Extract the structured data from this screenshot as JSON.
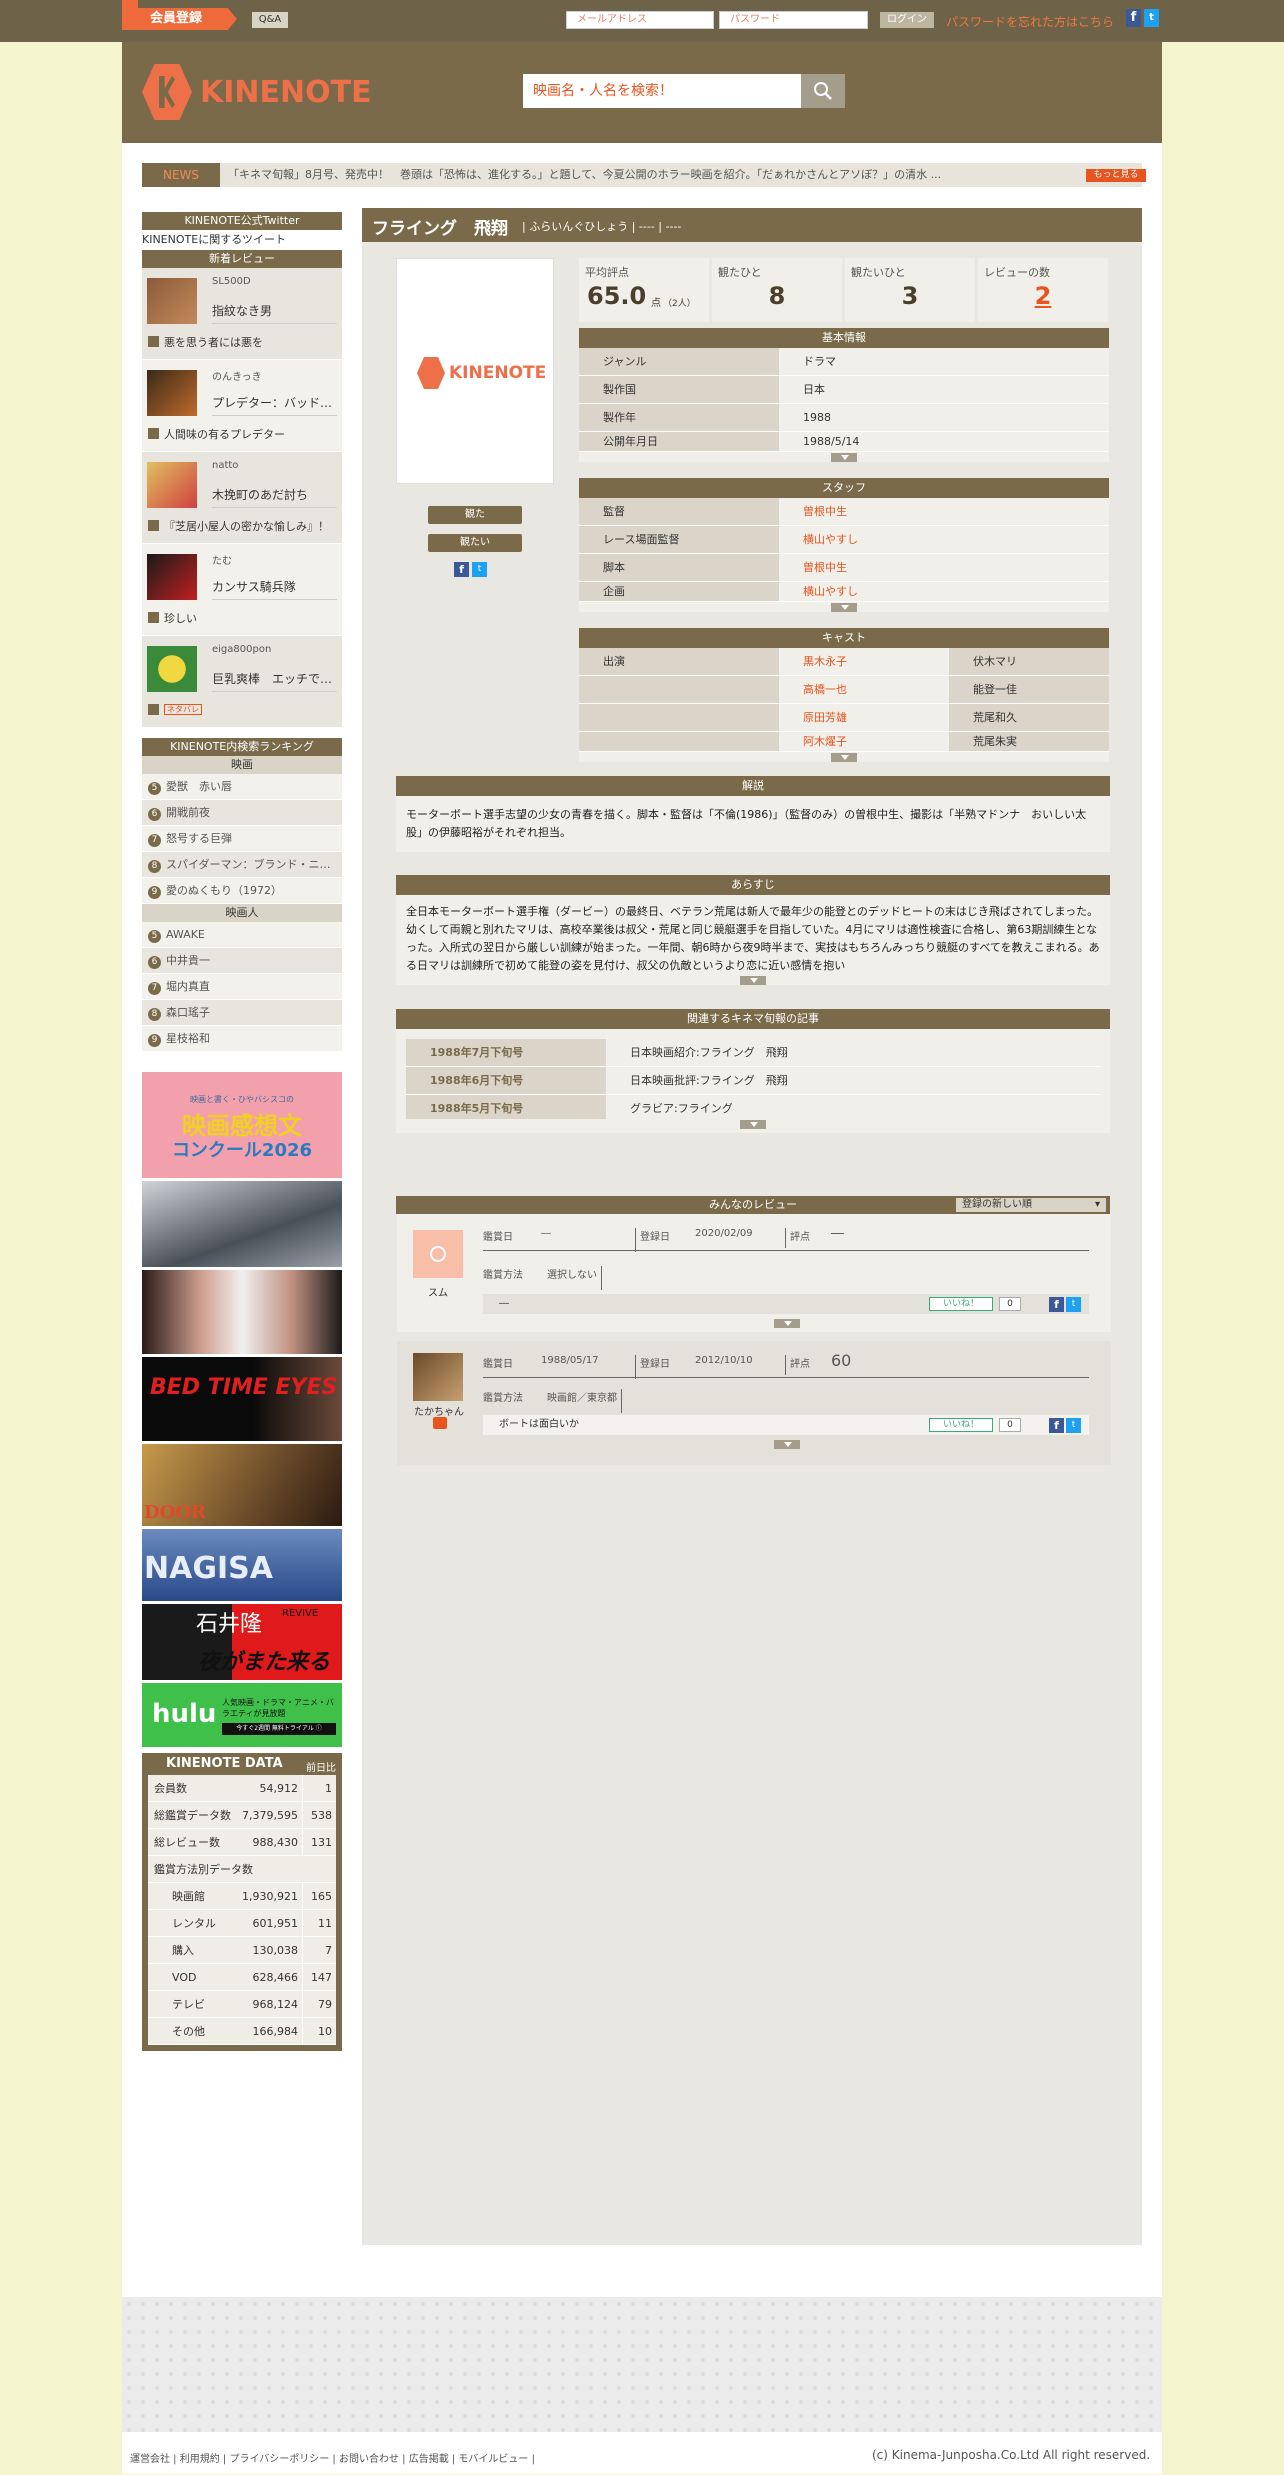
{
  "topbar": {
    "signup": "会員登録",
    "qa": "Q&A",
    "email_placeholder": "メールアドレス",
    "password_placeholder": "パスワード",
    "login": "ログイン",
    "forgot": "パスワードを忘れた方はこちら"
  },
  "header": {
    "logo": "KINENOTE",
    "search_placeholder": "映画名・人名を検索！"
  },
  "news": {
    "label": "NEWS",
    "text": "「キネマ旬報」8月号、発売中！　巻頭は「恐怖は、進化する。」と題して、今夏公開のホラー映画を紹介。「だぁれかさんとアソぼ？」の清水 ...",
    "more": "もっと見る"
  },
  "sidebar": {
    "twitter_head": "KINENOTE公式Twitter",
    "twitter_link": "KINENOTEに関するツイート",
    "reviews_head": "新着レビュー",
    "reviews": [
      {
        "user": "SL500D",
        "movie": "指紋なき男",
        "text": "悪を思う者には悪を"
      },
      {
        "user": "のんきっき",
        "movie": "プレデター：バッド…",
        "text": "人間味の有るプレデター"
      },
      {
        "user": "natto",
        "movie": "木挽町のあだ討ち",
        "text": "『芝居小屋人の密かな愉しみ』！"
      },
      {
        "user": "たむ",
        "movie": "カンサス騎兵隊",
        "text": "珍しい"
      },
      {
        "user": "eiga800pon",
        "movie": "巨乳爽棒　エッチで…",
        "text": "ネタバレ"
      }
    ],
    "ranking_head": "KINENOTE内検索ランキング",
    "ranking_movie_head": "映画",
    "ranking_movies": [
      {
        "n": "5",
        "t": "愛獣　赤い唇"
      },
      {
        "n": "6",
        "t": "開戦前夜"
      },
      {
        "n": "7",
        "t": "怒号する巨弾"
      },
      {
        "n": "8",
        "t": "スパイダーマン：ブランド・ニ…"
      },
      {
        "n": "9",
        "t": "愛のぬくもり（1972）"
      }
    ],
    "ranking_person_head": "映画人",
    "ranking_persons": [
      {
        "n": "5",
        "t": "AWAKE"
      },
      {
        "n": "6",
        "t": "中井貴一"
      },
      {
        "n": "7",
        "t": "堀内真直"
      },
      {
        "n": "8",
        "t": "森口瑤子"
      },
      {
        "n": "9",
        "t": "星枝裕和"
      }
    ],
    "banners": {
      "contest_small": "映画と書く・ひやバシスコの",
      "contest_line1": "映画感想文",
      "contest_line2": "コンクール2026",
      "bed_time": "BED TIME EYES",
      "door": "DOOR",
      "nagisa": "NAGISA",
      "ishii_name": "石井隆",
      "ishii_revive": "REVIVE",
      "ishii_title": "夜がまた来る",
      "hulu": "hulu",
      "hulu_text": "人気映画・ドラマ・アニメ・バラエティが見放題",
      "hulu_btn": "今すぐ2週間 無料トライアル ⓘ"
    },
    "data_head": "KINENOTE DATA",
    "data_prev": "前日比",
    "data_rows": [
      {
        "k": "会員数",
        "v": "54,912",
        "d": "1"
      },
      {
        "k": "総鑑賞データ数",
        "v": "7,379,595",
        "d": "538"
      },
      {
        "k": "総レビュー数",
        "v": "988,430",
        "d": "131"
      }
    ],
    "data_sub": "鑑賞方法別データ数",
    "data_methods": [
      {
        "k": "映画館",
        "v": "1,930,921",
        "d": "165"
      },
      {
        "k": "レンタル",
        "v": "601,951",
        "d": "11"
      },
      {
        "k": "購入",
        "v": "130,038",
        "d": "7"
      },
      {
        "k": "VOD",
        "v": "628,466",
        "d": "147"
      },
      {
        "k": "テレビ",
        "v": "968,124",
        "d": "79"
      },
      {
        "k": "その他",
        "v": "166,984",
        "d": "10"
      }
    ]
  },
  "movie": {
    "title": "フライング　飛翔",
    "sub": "ふらいんぐひしょう",
    "sub2": "----",
    "sub3": "----",
    "poster_logo": "KINENOTE",
    "btn_watched": "観た",
    "btn_want": "観たい",
    "stats": [
      {
        "label": "平均評点",
        "value": "65.0",
        "unit": "点",
        "count": "（2人）"
      },
      {
        "label": "観たひと",
        "value": "8"
      },
      {
        "label": "観たいひと",
        "value": "3"
      },
      {
        "label": "レビューの数",
        "value": "2"
      }
    ],
    "basic_head": "基本情報",
    "basic": [
      {
        "k": "ジャンル",
        "v": "ドラマ"
      },
      {
        "k": "製作国",
        "v": "日本"
      },
      {
        "k": "製作年",
        "v": "1988"
      },
      {
        "k": "公開年月日",
        "v": "1988/5/14"
      }
    ],
    "staff_head": "スタッフ",
    "staff": [
      {
        "k": "監督",
        "v": "曽根中生"
      },
      {
        "k": "レース場面監督",
        "v": "横山やすし"
      },
      {
        "k": "脚本",
        "v": "曽根中生"
      },
      {
        "k": "企画",
        "v": "横山やすし"
      }
    ],
    "cast_head": "キャスト",
    "cast_label": "出演",
    "cast": [
      {
        "actor": "黒木永子",
        "role": "伏木マリ"
      },
      {
        "actor": "高橋一也",
        "role": "能登一佳"
      },
      {
        "actor": "原田芳雄",
        "role": "荒尾和久"
      },
      {
        "actor": "阿木燿子",
        "role": "荒尾朱実"
      }
    ],
    "commentary_head": "解説",
    "commentary": "モーターボート選手志望の少女の青春を描く。脚本・監督は「不倫(1986)」（監督のみ）の曽根中生、撮影は「半熟マドンナ　おいしい太股」の伊藤昭裕がそれぞれ担当。",
    "synopsis_head": "あらすじ",
    "synopsis": "全日本モーターボート選手権（ダービー）の最終日、ベテラン荒尾は新人で最年少の能登とのデッドヒートの末はじき飛ばされてしまった。幼くして両親と別れたマリは、高校卒業後は叔父・荒尾と同じ競艇選手を目指していた。4月にマリは適性検査に合格し、第63期訓練生となった。入所式の翌日から厳しい訓練が始まった。一年間、朝6時から夜9時半まで、実技はもちろんみっちり競艇のすべてを教えこまれる。ある日マリは訓練所で初めて能登の姿を見付け、叔父の仇敵というより恋に近い感情を抱い",
    "articles_head": "関連するキネマ旬報の記事",
    "articles": [
      {
        "date": "1988年7月下旬号",
        "title": "日本映画紹介:フライング　飛翔"
      },
      {
        "date": "1988年6月下旬号",
        "title": "日本映画批評:フライング　飛翔"
      },
      {
        "date": "1988年5月下旬号",
        "title": "グラビア:フライング"
      }
    ],
    "reviews_head": "みんなのレビュー",
    "sort": "登録の新しい順",
    "reviews": [
      {
        "user": "スム",
        "watch_date": "―",
        "reg_date": "2020/02/09",
        "score": "―",
        "method": "選択しない",
        "text": "―",
        "likes": "0"
      },
      {
        "user": "たかちゃん",
        "watch_date": "1988/05/17",
        "reg_date": "2012/10/10",
        "score": "60",
        "method": "映画館／東京都",
        "text": "ボートは面白いか",
        "likes": "0"
      }
    ],
    "labels": {
      "watch_date": "鑑賞日",
      "reg_date": "登録日",
      "score": "評点",
      "method": "鑑賞方法",
      "like": "いいね！"
    }
  },
  "footer": {
    "links": "運営会社 | 利用規約 | プライバシーポリシー | お問い合わせ | 広告掲載 | モバイルビュー |",
    "copyright": "(c) Kinema-Junposha.Co.Ltd All right reserved."
  },
  "colors": {
    "brown": "#7a6a4a",
    "orange": "#e8541e",
    "bg": "#f4f5cf"
  }
}
